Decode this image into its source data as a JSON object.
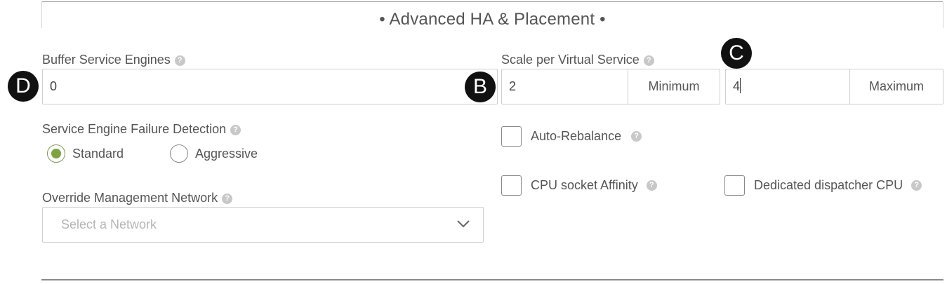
{
  "section": {
    "title": "• Advanced HA & Placement •"
  },
  "buffer_service_engines": {
    "label": "Buffer Service Engines",
    "value": "0"
  },
  "scale_per_virtual_service": {
    "label": "Scale per Virtual Service",
    "minimum": {
      "value": "2",
      "addon": "Minimum"
    },
    "maximum": {
      "value": "4",
      "addon": "Maximum"
    }
  },
  "failure_detection": {
    "label": "Service Engine Failure Detection",
    "options": [
      {
        "label": "Standard",
        "checked": true
      },
      {
        "label": "Aggressive",
        "checked": false
      }
    ]
  },
  "checkboxes": {
    "auto_rebalance": {
      "label": "Auto-Rebalance",
      "checked": false
    },
    "cpu_socket_affinity": {
      "label": "CPU socket Affinity",
      "checked": false
    },
    "dedicated_dispatcher_cpu": {
      "label": "Dedicated dispatcher CPU",
      "checked": false
    }
  },
  "override_management_network": {
    "label": "Override Management Network",
    "placeholder": "Select a Network"
  },
  "help_icon": {
    "glyph": "?",
    "icon": "question-circle-icon",
    "color": "#c8c8c8"
  },
  "callouts": {
    "b": "B",
    "c": "C",
    "d": "D"
  },
  "colors": {
    "radio_accent": "#7fa33f",
    "badge_bg": "#111111",
    "border": "#cfcfcf"
  }
}
